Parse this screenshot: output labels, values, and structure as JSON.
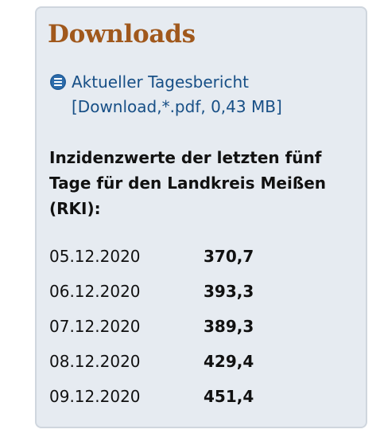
{
  "downloads": {
    "title": "Downloads",
    "link": {
      "label": "Aktueller Tagesbericht",
      "meta": "[Download,*.pdf, 0,43 MB]",
      "icon": "list-bullet-icon"
    }
  },
  "incidence": {
    "heading": "Inzidenzwerte der letzten fünf Tage für den Landkreis Meißen (RKI):",
    "rows": [
      {
        "date": "05.12.2020",
        "value": "370,7"
      },
      {
        "date": "06.12.2020",
        "value": "393,3"
      },
      {
        "date": "07.12.2020",
        "value": "389,3"
      },
      {
        "date": "08.12.2020",
        "value": "429,4"
      },
      {
        "date": "09.12.2020",
        "value": "451,4"
      }
    ]
  },
  "colors": {
    "panel_background": "#e6ebf1",
    "panel_border": "#cfd6de",
    "title": "#a0581c",
    "link": "#174f86",
    "text": "#111111"
  }
}
